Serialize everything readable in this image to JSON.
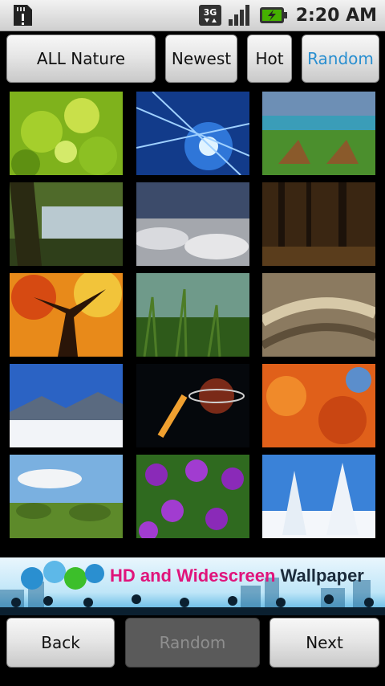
{
  "status_bar": {
    "time": "2:20 AM",
    "network": "3G",
    "icons": [
      "sd-card-alert-icon",
      "3g-data-icon",
      "signal-strength-icon",
      "battery-charging-icon"
    ]
  },
  "tabs": [
    {
      "label": "ALL Nature",
      "selected": false
    },
    {
      "label": "Newest",
      "selected": false
    },
    {
      "label": "Hot",
      "selected": false
    },
    {
      "label": "Random",
      "selected": true
    }
  ],
  "accent_color": "#2a8fd0",
  "thumbnails": [
    "green-leaves",
    "blue-ice-burst",
    "beach-chairs",
    "forest-lake",
    "clouds-from-above",
    "dark-forest",
    "autumn-tree",
    "grass-closeup",
    "golden-wheat",
    "snowy-mountains",
    "space-planets",
    "orange-autumn-leaves",
    "green-hills",
    "purple-flowers",
    "snowy-trees"
  ],
  "banner": {
    "text_part1": "HD and Widescreen",
    "text_part2": "Wallpaper"
  },
  "bottom_nav": {
    "back_label": "Back",
    "random_label": "Random",
    "next_label": "Next"
  }
}
